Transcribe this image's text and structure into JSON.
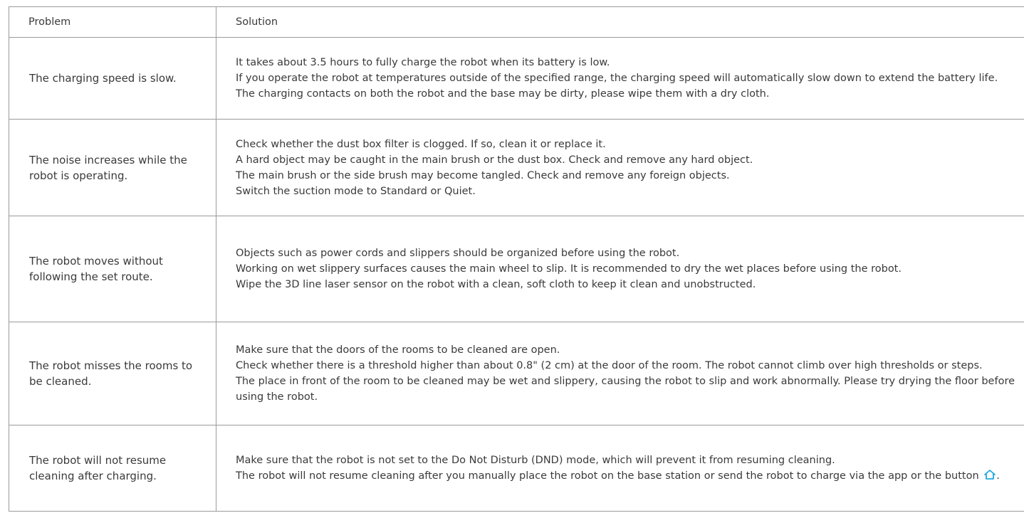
{
  "headers": {
    "problem": "Problem",
    "solution": "Solution"
  },
  "rows": [
    {
      "problem": "The charging speed is slow.",
      "solutions": [
        "It takes about 3.5 hours to fully charge the robot when its battery is low.",
        "If you operate the robot at temperatures outside of the specified range, the charging speed will automatically slow down to extend the battery life.",
        "The charging contacts on both the robot and the base may be dirty, please wipe them with a dry cloth."
      ]
    },
    {
      "problem": "The noise increases while the robot is operating.",
      "solutions": [
        "Check whether the dust box filter is clogged. If so, clean it or replace it.",
        "A hard object may be caught in the main brush or the dust box. Check and remove any hard object.",
        "The main brush or the side brush may become tangled. Check and remove any foreign objects.",
        "Switch the suction mode to Standard or Quiet."
      ]
    },
    {
      "problem": "The robot moves without following the set route.",
      "solutions": [
        "Objects such as power cords and slippers should be organized before using the robot.",
        "Working on wet slippery surfaces causes the main wheel to slip. It is recommended to dry the wet places before using the robot.",
        "Wipe the 3D line laser sensor on the robot with a clean, soft cloth to keep it clean and unobstructed."
      ]
    },
    {
      "problem": "The robot misses the rooms to be cleaned.",
      "solutions": [
        "Make sure that the doors of the rooms to be cleaned are open.",
        "Check whether there is a threshold higher than about 0.8\" (2 cm) at the door of the room. The robot cannot climb over high thresholds or steps.",
        "The place in front of the room to be cleaned may be wet and slippery, causing the robot to slip and work abnormally. Please try drying the floor before using the robot."
      ]
    },
    {
      "problem": "The robot will not resume cleaning after charging.",
      "solutions": [
        "Make sure that the robot is not set to the Do Not Disturb (DND) mode, which will prevent it from resuming cleaning.",
        "The robot will not resume cleaning after you manually place the robot on the base station or send the robot to charge via the app or the button"
      ],
      "trailing_punct": ".",
      "icon": "home-icon",
      "icon_color": "#1fa8e0"
    }
  ]
}
